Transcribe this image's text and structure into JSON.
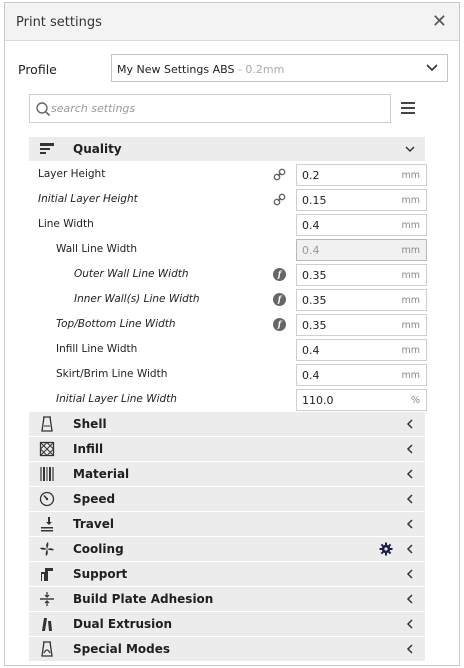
{
  "window": {
    "title": "Print settings"
  },
  "profile": {
    "label": "Profile",
    "name": "My New Settings ABS",
    "suffix": " - 0.2mm"
  },
  "search": {
    "placeholder": "search settings"
  },
  "quality": {
    "label": "Quality",
    "settings": [
      {
        "label": "Layer Height",
        "value": "0.2",
        "unit": "mm"
      },
      {
        "label": "Initial Layer Height",
        "value": "0.15",
        "unit": "mm"
      },
      {
        "label": "Line Width",
        "value": "0.4",
        "unit": "mm"
      },
      {
        "label": "Wall Line Width",
        "value": "0.4",
        "unit": "mm"
      },
      {
        "label": "Outer Wall Line Width",
        "value": "0.35",
        "unit": "mm"
      },
      {
        "label": "Inner Wall(s) Line Width",
        "value": "0.35",
        "unit": "mm"
      },
      {
        "label": "Top/Bottom Line Width",
        "value": "0.35",
        "unit": "mm"
      },
      {
        "label": "Infill Line Width",
        "value": "0.4",
        "unit": "mm"
      },
      {
        "label": "Skirt/Brim Line Width",
        "value": "0.4",
        "unit": "mm"
      },
      {
        "label": "Initial Layer Line Width",
        "value": "110.0",
        "unit": "%"
      }
    ]
  },
  "categories": [
    {
      "label": "Shell",
      "icon": "shell-icon"
    },
    {
      "label": "Infill",
      "icon": "infill-icon"
    },
    {
      "label": "Material",
      "icon": "material-icon"
    },
    {
      "label": "Speed",
      "icon": "speed-icon"
    },
    {
      "label": "Travel",
      "icon": "travel-icon"
    },
    {
      "label": "Cooling",
      "icon": "cooling-icon"
    },
    {
      "label": "Support",
      "icon": "support-icon"
    },
    {
      "label": "Build Plate Adhesion",
      "icon": "build-plate-adhesion-icon"
    },
    {
      "label": "Dual Extrusion",
      "icon": "dual-extrusion-icon"
    },
    {
      "label": "Special Modes",
      "icon": "special-modes-icon"
    }
  ],
  "colors": {
    "category_bg": "#ececec",
    "gear_accent": "#1c1f4a"
  }
}
